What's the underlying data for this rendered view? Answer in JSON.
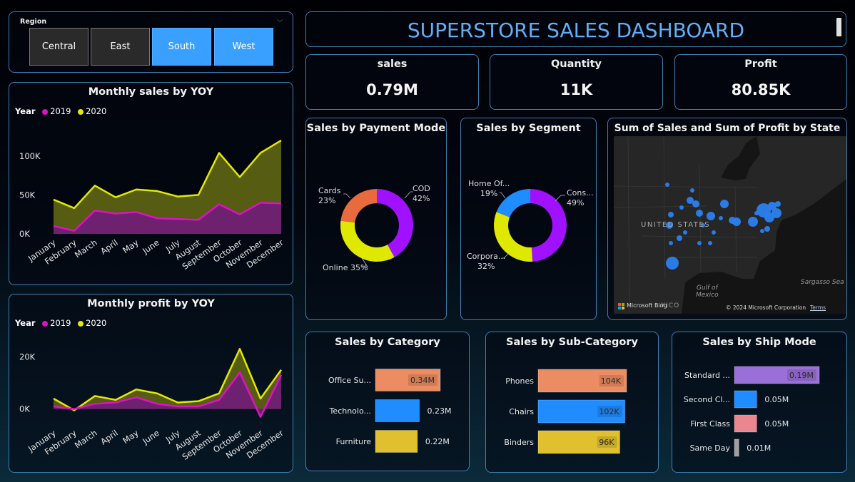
{
  "colors": {
    "y2019": "#e010c8",
    "y2020": "#e2ea00",
    "area2019": "#6f1d74",
    "area2020": "#5c6114",
    "btn_selected": "#3aa0ff",
    "btn_unselected": "#2a2a2a",
    "title_blue": "#63aef4",
    "donut_purple": "#a011ff",
    "donut_orange": "#e96a3c",
    "donut_yellow": "#dfe800",
    "donut_blue": "#1f8cff",
    "bar_orange": "#ec8c62",
    "bar_blue": "#1f8cff",
    "bar_yellow": "#e0c02e",
    "bar_lavender": "#9a6fd8",
    "bar_pink": "#e9868f",
    "bar_gray": "#a0a0a0",
    "map_bubble": "#2a7ff0"
  },
  "slicer": {
    "title": "Region",
    "options": [
      {
        "label": "Central",
        "selected": false
      },
      {
        "label": "East",
        "selected": false
      },
      {
        "label": "South",
        "selected": true
      },
      {
        "label": "West",
        "selected": true
      }
    ],
    "chevron_icon": "chevron-down-icon"
  },
  "header": {
    "title": "SUPERSTORE SALES DASHBOARD",
    "scrollbar_icon": "scrollbar-thumb"
  },
  "kpis": [
    {
      "label": "sales",
      "value": "0.79M"
    },
    {
      "label": "Quantity",
      "value": "11K"
    },
    {
      "label": "Profit",
      "value": "80.85K"
    }
  ],
  "legend": {
    "heading": "Year",
    "items": [
      "2019",
      "2020"
    ]
  },
  "chart_data": [
    {
      "type": "area",
      "title": "Monthly sales by YOY",
      "categories": [
        "January",
        "February",
        "March",
        "April",
        "May",
        "June",
        "July",
        "August",
        "September",
        "October",
        "November",
        "December"
      ],
      "series": [
        {
          "name": "2019",
          "values": [
            10000,
            4000,
            30000,
            26000,
            28000,
            20000,
            19000,
            18000,
            38000,
            25000,
            40000,
            39000
          ]
        },
        {
          "name": "2020",
          "values": [
            44000,
            33000,
            62000,
            47000,
            57000,
            55000,
            48000,
            50000,
            104000,
            73000,
            104000,
            120000
          ]
        }
      ],
      "yticks": [
        "0K",
        "50K",
        "100K"
      ],
      "ytick_values": [
        0,
        50000,
        100000
      ],
      "ylim": [
        0,
        130000
      ],
      "stacked": false,
      "legend": "top-left"
    },
    {
      "type": "area",
      "title": "Monthly profit by YOY",
      "categories": [
        "January",
        "February",
        "March",
        "April",
        "May",
        "June",
        "July",
        "August",
        "September",
        "October",
        "November",
        "December"
      ],
      "series": [
        {
          "name": "2019",
          "values": [
            1000,
            0,
            2000,
            2500,
            4500,
            2000,
            1000,
            1000,
            3500,
            14000,
            -3000,
            13000
          ]
        },
        {
          "name": "2020",
          "values": [
            4000,
            -500,
            5000,
            3500,
            7500,
            6000,
            2500,
            3000,
            6000,
            23000,
            4000,
            15000
          ]
        }
      ],
      "yticks": [
        "0K",
        "20K"
      ],
      "ytick_values": [
        0,
        20000
      ],
      "ylim": [
        -5000,
        25000
      ],
      "stacked": false,
      "legend": "top-left"
    },
    {
      "type": "pie",
      "title": "Sales by Payment Mode",
      "donut": true,
      "slices": [
        {
          "label": "COD",
          "value": 42,
          "display": "COD\n42%"
        },
        {
          "label": "Online",
          "value": 35,
          "display": "Online 35%"
        },
        {
          "label": "Cards",
          "value": 23,
          "display": "Cards\n23%"
        }
      ]
    },
    {
      "type": "pie",
      "title": "Sales by Segment",
      "donut": true,
      "slices": [
        {
          "label": "Cons...",
          "value": 49,
          "display": "Cons...\n49%"
        },
        {
          "label": "Corpora...",
          "value": 32,
          "display": "Corpora...\n32%"
        },
        {
          "label": "Home Of...",
          "value": 19,
          "display": "Home Of...\n19%"
        }
      ]
    },
    {
      "type": "bar",
      "orientation": "horizontal",
      "title": "Sales by Category",
      "categories": [
        "Office Su...",
        "Technolo...",
        "Furniture"
      ],
      "values": [
        0.34,
        0.23,
        0.22
      ],
      "value_labels": [
        "0.34M",
        "0.23M",
        "0.22M"
      ],
      "xlim": [
        0,
        0.34
      ]
    },
    {
      "type": "bar",
      "orientation": "horizontal",
      "title": "Sales by Sub-Category",
      "categories": [
        "Phones",
        "Chairs",
        "Binders"
      ],
      "values": [
        104,
        102,
        96
      ],
      "value_labels": [
        "104K",
        "102K",
        "96K"
      ],
      "xlim": [
        0,
        104
      ]
    },
    {
      "type": "bar",
      "orientation": "horizontal",
      "title": "Sales by Ship Mode",
      "categories": [
        "Standard ...",
        "Second Cl...",
        "First Class",
        "Same Day"
      ],
      "values": [
        0.19,
        0.05,
        0.05,
        0.01
      ],
      "value_labels": [
        "0.19M",
        "0.05M",
        "0.05M",
        "0.01M"
      ],
      "xlim": [
        0,
        0.19
      ]
    }
  ],
  "map": {
    "title": "Sum of Sales and Sum of Profit by State",
    "country_label": "UNITED STATES",
    "gulf_label": "Gulf of\nMexico",
    "sea_label": "Sargasso Sea",
    "mexico_label": "XICO",
    "bing_label": "Microsoft Bing",
    "copyright": "© 2024 Microsoft Corporation",
    "terms": "Terms",
    "bing_icon": "microsoft-logo-icon"
  }
}
